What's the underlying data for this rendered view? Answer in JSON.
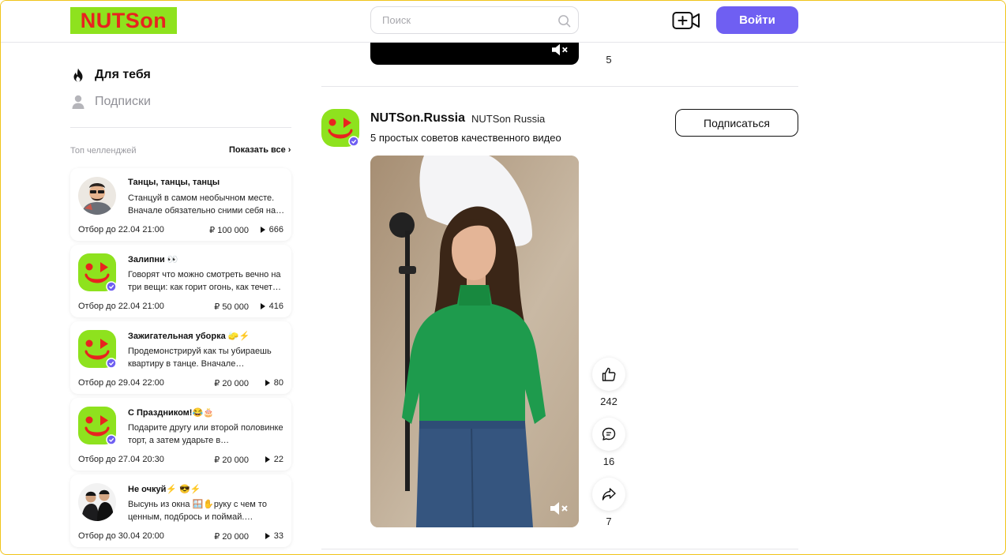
{
  "header": {
    "logo_text": "NUTSon",
    "search_placeholder": "Поиск",
    "login_label": "Войти"
  },
  "colors": {
    "brand_green": "#8ee21e",
    "brand_red": "#e8231f",
    "accent_purple": "#6f5ff2",
    "verified_blue": "#6f5ff2"
  },
  "sidebar": {
    "nav": [
      {
        "label": "Для тебя",
        "icon": "flame-icon",
        "active": true
      },
      {
        "label": "Подписки",
        "icon": "user-icon",
        "active": false
      }
    ],
    "challenges_title": "Топ челленджей",
    "show_all_label": "Показать все ›",
    "challenges": [
      {
        "title": "Танцы, танцы, танцы",
        "desc": "Станцуй в самом необычном месте. Вначале обязательно сними себя на…",
        "deadline": "Отбор до 22.04 21:00",
        "prize": "₽ 100 000",
        "views": "666",
        "avatar": "person-avatar"
      },
      {
        "title": "Залипни 👀",
        "desc": "Говорят что можно смотреть вечно на три вещи: как горит огонь, как течет…",
        "deadline": "Отбор до 22.04 21:00",
        "prize": "₽ 50 000",
        "views": "416",
        "avatar": "nutson-logo-avatar"
      },
      {
        "title": "Зажигательная уборка 🧽⚡",
        "desc": "Продемонстрируй как ты убираешь квартиру в танце. Вначале…",
        "deadline": "Отбор до 29.04 22:00",
        "prize": "₽ 20 000",
        "views": "80",
        "avatar": "nutson-logo-avatar"
      },
      {
        "title": "С Праздником!😂🎂",
        "desc": "Подарите другу или второй половинке торт, а затем ударьте в…",
        "deadline": "Отбор до 27.04 20:30",
        "prize": "₽ 20 000",
        "views": "22",
        "avatar": "nutson-logo-avatar"
      },
      {
        "title": "Не очкуй⚡ 😎⚡",
        "desc": "Высунь из окна 🪟✋руку с чем то ценным, подбрось и поймай.…",
        "deadline": "Отбор до 30.04 20:00",
        "prize": "₽ 20 000",
        "views": "33",
        "avatar": "duo-avatar"
      }
    ]
  },
  "feed": {
    "prev_post_count": "5",
    "post": {
      "username": "NUTSon.Russia",
      "display_name": "NUTSon Russia",
      "caption": "5 простых советов качественного видео",
      "subscribe_label": "Подписаться",
      "likes": "242",
      "comments": "16",
      "shares": "7"
    }
  }
}
